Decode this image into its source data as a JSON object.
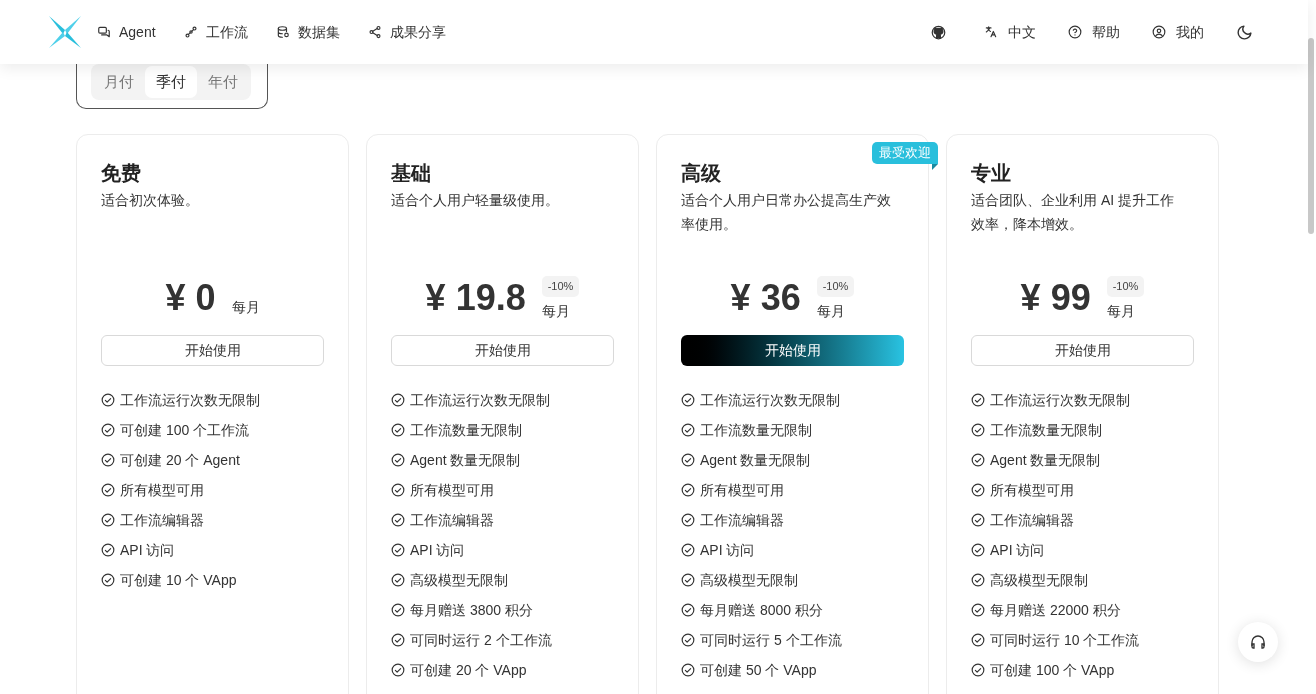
{
  "nav": [
    "Agent",
    "工作流",
    "数据集",
    "成果分享"
  ],
  "nav_right": [
    "中文",
    "帮助",
    "我的"
  ],
  "billing_tabs": [
    {
      "label": "月付",
      "selected": false
    },
    {
      "label": "季付",
      "selected": true
    },
    {
      "label": "年付",
      "selected": false
    }
  ],
  "plans": [
    {
      "name": "免费",
      "description": "适合初次体验。",
      "price": "¥ 0",
      "period": "每月",
      "button": "开始使用",
      "kind": "outline",
      "features": [
        "工作流运行次数无限制",
        "可创建 100 个工作流",
        "可创建 20 个 Agent",
        "所有模型可用",
        "工作流编辑器",
        "API 访问",
        "可创建 10 个 VApp"
      ]
    },
    {
      "name": "基础",
      "description": "适合个人用户轻量级使用。",
      "price": "¥ 19.8",
      "discount": "-10%",
      "period": "每月",
      "button": "开始使用",
      "kind": "outline",
      "features": [
        "工作流运行次数无限制",
        "工作流数量无限制",
        "Agent 数量无限制",
        "所有模型可用",
        "工作流编辑器",
        "API 访问",
        "高级模型无限制",
        "每月赠送 3800 积分",
        "可同时运行 2 个工作流",
        "可创建 20 个 VApp"
      ]
    },
    {
      "name": "高级",
      "description": "适合个人用户日常办公提高生产效率使用。",
      "price": "¥ 36",
      "discount": "-10%",
      "period": "每月",
      "button": "开始使用",
      "kind": "primary",
      "badge": "最受欢迎",
      "features": [
        "工作流运行次数无限制",
        "工作流数量无限制",
        "Agent 数量无限制",
        "所有模型可用",
        "工作流编辑器",
        "API 访问",
        "高级模型无限制",
        "每月赠送 8000 积分",
        "可同时运行 5 个工作流",
        "可创建 50 个 VApp"
      ]
    },
    {
      "name": "专业",
      "description": "适合团队、企业利用 AI 提升工作效率，降本增效。",
      "price": "¥ 99",
      "discount": "-10%",
      "period": "每月",
      "button": "开始使用",
      "kind": "outline",
      "features": [
        "工作流运行次数无限制",
        "工作流数量无限制",
        "Agent 数量无限制",
        "所有模型可用",
        "工作流编辑器",
        "API 访问",
        "高级模型无限制",
        "每月赠送 22000 积分",
        "可同时运行 10 个工作流",
        "可创建 100 个 VApp"
      ]
    }
  ]
}
